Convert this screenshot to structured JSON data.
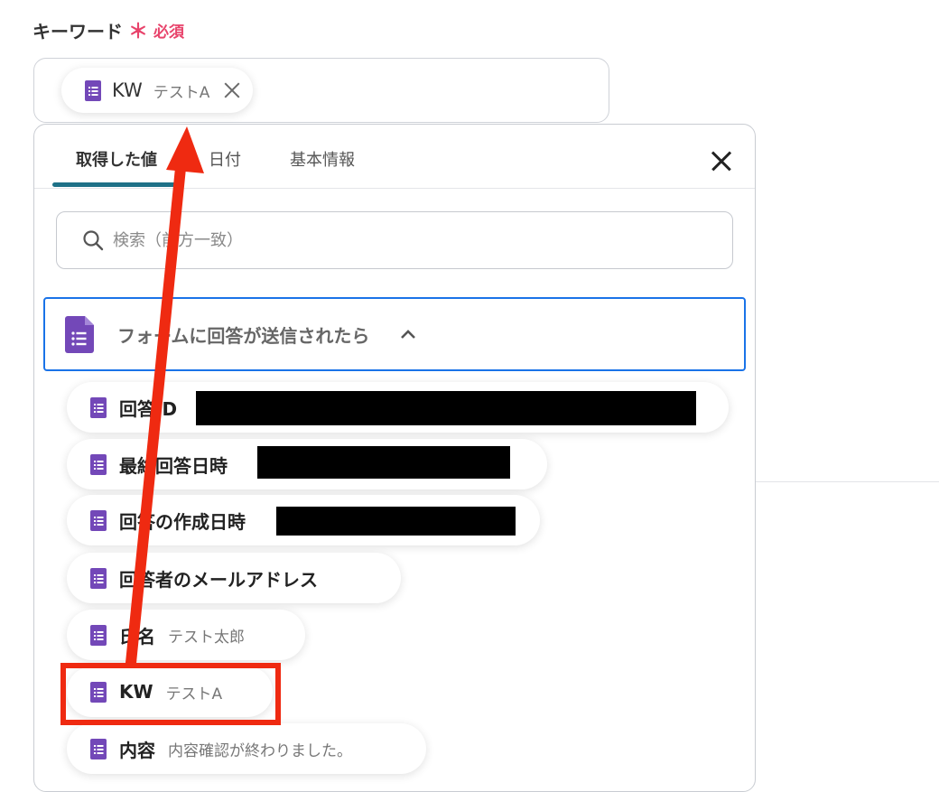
{
  "field": {
    "label": "キーワード",
    "required_mark": "＊",
    "required_text": "必須"
  },
  "selected_chip": {
    "name": "KW",
    "value": "テストA"
  },
  "panel": {
    "tabs": [
      {
        "label": "取得した値",
        "active": true
      },
      {
        "label": "日付",
        "active": false
      },
      {
        "label": "基本情報",
        "active": false
      }
    ],
    "search_placeholder": "検索（前方一致）",
    "section_title": "フォームに回答が送信されたら",
    "items": [
      {
        "name": "回答ID",
        "value": ""
      },
      {
        "name": "最終回答日時",
        "value": ""
      },
      {
        "name": "回答の作成日時",
        "value": ""
      },
      {
        "name": "回答者のメールアドレス",
        "value": ""
      },
      {
        "name": "氏名",
        "value": "テスト太郎"
      },
      {
        "name": "KW",
        "value": "テストA"
      },
      {
        "name": "内容",
        "value": "内容確認が終わりました。"
      }
    ]
  },
  "colors": {
    "required": "#e8436b",
    "forms_purple": "#7348b8",
    "tab_underline": "#1e7187",
    "focus_border": "#1a73e8",
    "annotation_red": "#ef2a11"
  },
  "icons": {
    "form_icon": "google-forms-document-icon",
    "search": "magnifier-icon",
    "close": "x-icon",
    "collapse": "chevron-up-icon"
  }
}
